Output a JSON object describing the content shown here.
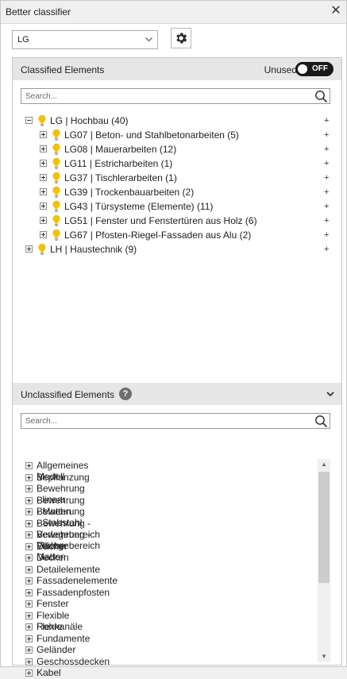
{
  "window": {
    "title": "Better classifier",
    "close_glyph": "✕"
  },
  "toolbar": {
    "dropdown_value": "LG",
    "dropdown_icon": "chevron-down-icon",
    "settings_icon": "gear-icon"
  },
  "classified": {
    "title": "Classified Elements",
    "unused_label": "Unused",
    "toggle_text": "OFF",
    "search_placeholder": "Search...",
    "tree": [
      {
        "label": "LG | Hochbau (40)",
        "expanded": true,
        "level": 0
      },
      {
        "label": "LG07 | Beton- und Stahlbetonarbeiten (5)",
        "expanded": false,
        "level": 1
      },
      {
        "label": "LG08 | Mauerarbeiten (12)",
        "expanded": false,
        "level": 1
      },
      {
        "label": "LG11 | Estricharbeiten (1)",
        "expanded": false,
        "level": 1
      },
      {
        "label": "LG37 | Tischlerarbeiten (1)",
        "expanded": false,
        "level": 1
      },
      {
        "label": "LG39 | Trockenbauarbeiten (2)",
        "expanded": false,
        "level": 1
      },
      {
        "label": "LG43 | Türsysteme (Elemente) (11)",
        "expanded": false,
        "level": 1
      },
      {
        "label": "LG51 | Fenster und Fenstertüren aus Holz (6)",
        "expanded": false,
        "level": 1
      },
      {
        "label": "LG67 | Pfosten-Riegel-Fassaden aus Alu (2)",
        "expanded": false,
        "level": 1
      },
      {
        "label": "LH | Haustechnik (9)",
        "expanded": false,
        "level": 0
      }
    ],
    "row_action": "+"
  },
  "unclassified": {
    "title": "Unclassified Elements",
    "help_glyph": "?",
    "search_placeholder": "Search...",
    "items": [
      "Allgemeines Modell",
      "Bepflanzung",
      "Bewehrung - linear",
      "Bewehrung - Matten",
      "Bewehrung - Stabstahl",
      "Bewehrung - Verlegebereich Fläche",
      "Bewehrung - Verlegebereich Matten",
      "Dächer",
      "Decken",
      "Detailelemente",
      "Fassadenelemente",
      "Fassadenpfosten",
      "Fenster",
      "Flexible Rohre",
      "Flexkanäle",
      "Fundamente",
      "Geländer",
      "Geschossdecken",
      "Kabel"
    ],
    "scroll_up_glyph": "▲",
    "scroll_down_glyph": "▼"
  },
  "colors": {
    "bulb": "#f2c200",
    "toggle_bg": "#1a1a1a",
    "header_bg": "#e6e6e6"
  }
}
